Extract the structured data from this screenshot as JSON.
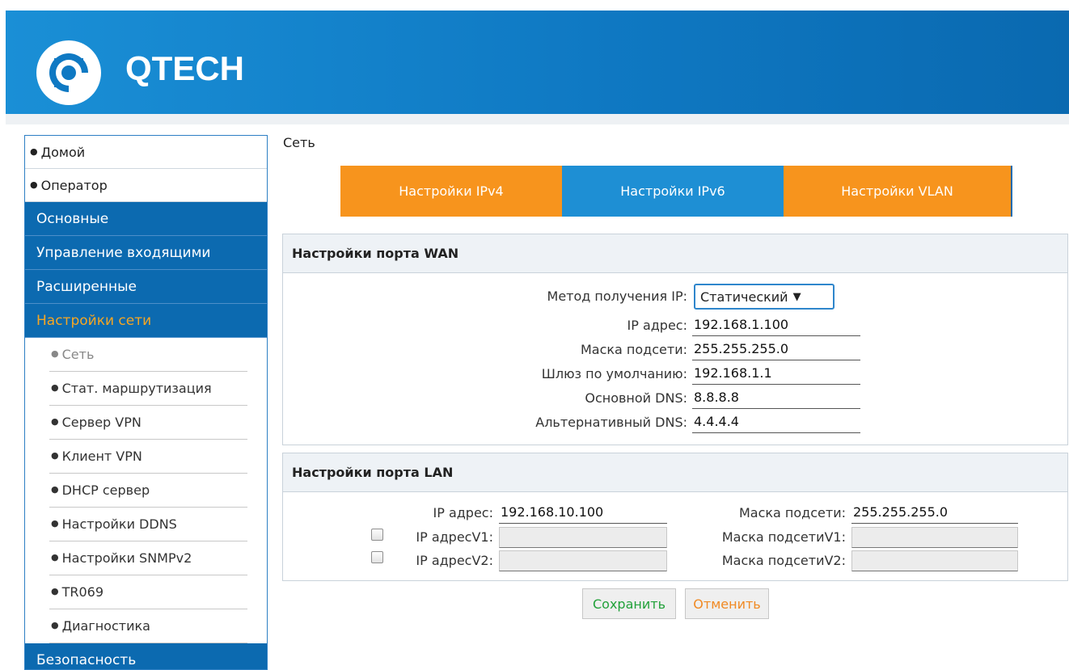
{
  "header": {
    "brand": "QTECH"
  },
  "sidebar": {
    "top_items": [
      {
        "label": "Домой"
      },
      {
        "label": "Оператор"
      }
    ],
    "sections": [
      {
        "label": "Основные"
      },
      {
        "label": "Управление входящими"
      },
      {
        "label": "Расширенные"
      },
      {
        "label": "Настройки сети",
        "active": true
      }
    ],
    "sub_items": [
      {
        "label": "Сеть",
        "current": true
      },
      {
        "label": "Стат. маршрутизация"
      },
      {
        "label": "Сервер VPN"
      },
      {
        "label": "Клиент VPN"
      },
      {
        "label": "DHCP сервер"
      },
      {
        "label": "Настройки DDNS"
      },
      {
        "label": "Настройки SNMPv2"
      },
      {
        "label": "TR069"
      },
      {
        "label": "Диагностика"
      }
    ],
    "bottom_section": {
      "label": "Безопасность"
    }
  },
  "main": {
    "breadcrumb": "Сеть",
    "tabs": [
      {
        "label": "Настройки IPv4",
        "color": "#f7941d"
      },
      {
        "label": "Настройки IPv6",
        "color": "#1e8fd4",
        "selected": true
      },
      {
        "label": "Настройки VLAN",
        "color": "#f7941d"
      }
    ],
    "wan": {
      "title": "Настройки порта WAN",
      "ip_method_label": "Метод получения IP:",
      "ip_method_value": "Статический",
      "ip_label": "IP адрес:",
      "ip_value": "192.168.1.100",
      "mask_label": "Маска подсети:",
      "mask_value": "255.255.255.0",
      "gateway_label": "Шлюз по умолчанию:",
      "gateway_value": "192.168.1.1",
      "dns1_label": "Основной DNS:",
      "dns1_value": "8.8.8.8",
      "dns2_label": "Альтернативный DNS:",
      "dns2_value": "4.4.4.4"
    },
    "lan": {
      "title": "Настройки порта LAN",
      "ip_label": "IP адрес:",
      "ip_value": "192.168.10.100",
      "mask_label": "Маска подсети:",
      "mask_value": "255.255.255.0",
      "ip_v1_label": "IP адресV1:",
      "ip_v1_value": "",
      "mask_v1_label": "Маска подсетиV1:",
      "mask_v1_value": "",
      "ip_v2_label": "IP адресV2:",
      "ip_v2_value": "",
      "mask_v2_label": "Маска подсетиV2:",
      "mask_v2_value": ""
    },
    "buttons": {
      "save": "Сохранить",
      "cancel": "Отменить"
    }
  },
  "colors": {
    "header_blue": "#0f79c3",
    "sidebar_blue": "#0c6ab0",
    "active_orange": "#f5a623",
    "tab_orange": "#f7941d",
    "tab_blue": "#1e8fd4",
    "save_green": "#22a13a",
    "cancel_orange": "#f08a24"
  },
  "icons": {
    "logo": "qtech-logo-icon",
    "caret": "caret-down-icon"
  }
}
